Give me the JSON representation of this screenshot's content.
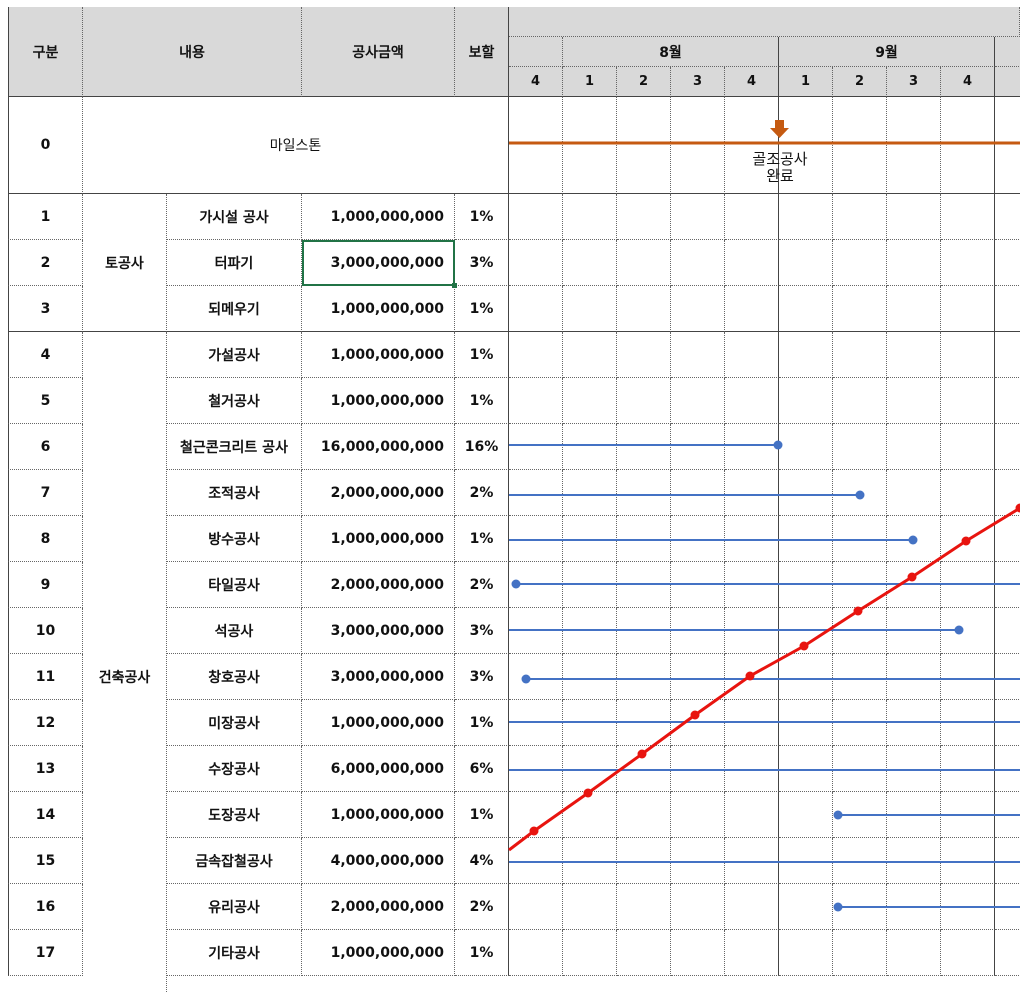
{
  "sheet": {
    "headers": {
      "gubun": "구분",
      "content": "내용",
      "amount": "공사금액",
      "retention": "보할"
    },
    "months": [
      "8월",
      "9월"
    ],
    "weeks": [
      "4",
      "1",
      "2",
      "3",
      "4",
      "1",
      "2",
      "3",
      "4"
    ],
    "milestone": {
      "id": "0",
      "label": "마일스톤",
      "marker_label_line1": "골조공사",
      "marker_label_line2": "완료",
      "marker_color": "#c55a11"
    },
    "groups": [
      {
        "name": "토공사"
      },
      {
        "name": "건축공사"
      }
    ],
    "rows": [
      {
        "id": "1",
        "name": "가시설 공사",
        "amount": "1,000,000,000",
        "ratio": "1%"
      },
      {
        "id": "2",
        "name": "터파기",
        "amount": "3,000,000,000",
        "ratio": "3%"
      },
      {
        "id": "3",
        "name": "되메우기",
        "amount": "1,000,000,000",
        "ratio": "1%"
      },
      {
        "id": "4",
        "name": "가설공사",
        "amount": "1,000,000,000",
        "ratio": "1%"
      },
      {
        "id": "5",
        "name": "철거공사",
        "amount": "1,000,000,000",
        "ratio": "1%"
      },
      {
        "id": "6",
        "name": "철근콘크리트 공사",
        "amount": "16,000,000,000",
        "ratio": "16%"
      },
      {
        "id": "7",
        "name": "조적공사",
        "amount": "2,000,000,000",
        "ratio": "2%"
      },
      {
        "id": "8",
        "name": "방수공사",
        "amount": "1,000,000,000",
        "ratio": "1%"
      },
      {
        "id": "9",
        "name": "타일공사",
        "amount": "2,000,000,000",
        "ratio": "2%"
      },
      {
        "id": "10",
        "name": "석공사",
        "amount": "3,000,000,000",
        "ratio": "3%"
      },
      {
        "id": "11",
        "name": "창호공사",
        "amount": "3,000,000,000",
        "ratio": "3%"
      },
      {
        "id": "12",
        "name": "미장공사",
        "amount": "1,000,000,000",
        "ratio": "1%"
      },
      {
        "id": "13",
        "name": "수장공사",
        "amount": "6,000,000,000",
        "ratio": "6%"
      },
      {
        "id": "14",
        "name": "도장공사",
        "amount": "1,000,000,000",
        "ratio": "1%"
      },
      {
        "id": "15",
        "name": "금속잡철공사",
        "amount": "4,000,000,000",
        "ratio": "4%"
      },
      {
        "id": "16",
        "name": "유리공사",
        "amount": "2,000,000,000",
        "ratio": "2%"
      },
      {
        "id": "17",
        "name": "기타공사",
        "amount": "1,000,000,000",
        "ratio": "1%"
      }
    ],
    "selected_cell": "amount of row 2",
    "colors": {
      "header_bg": "#d9d9d9",
      "task_bar": "#4472c4",
      "s_curve": "#e8140f",
      "selection": "#217346"
    }
  }
}
